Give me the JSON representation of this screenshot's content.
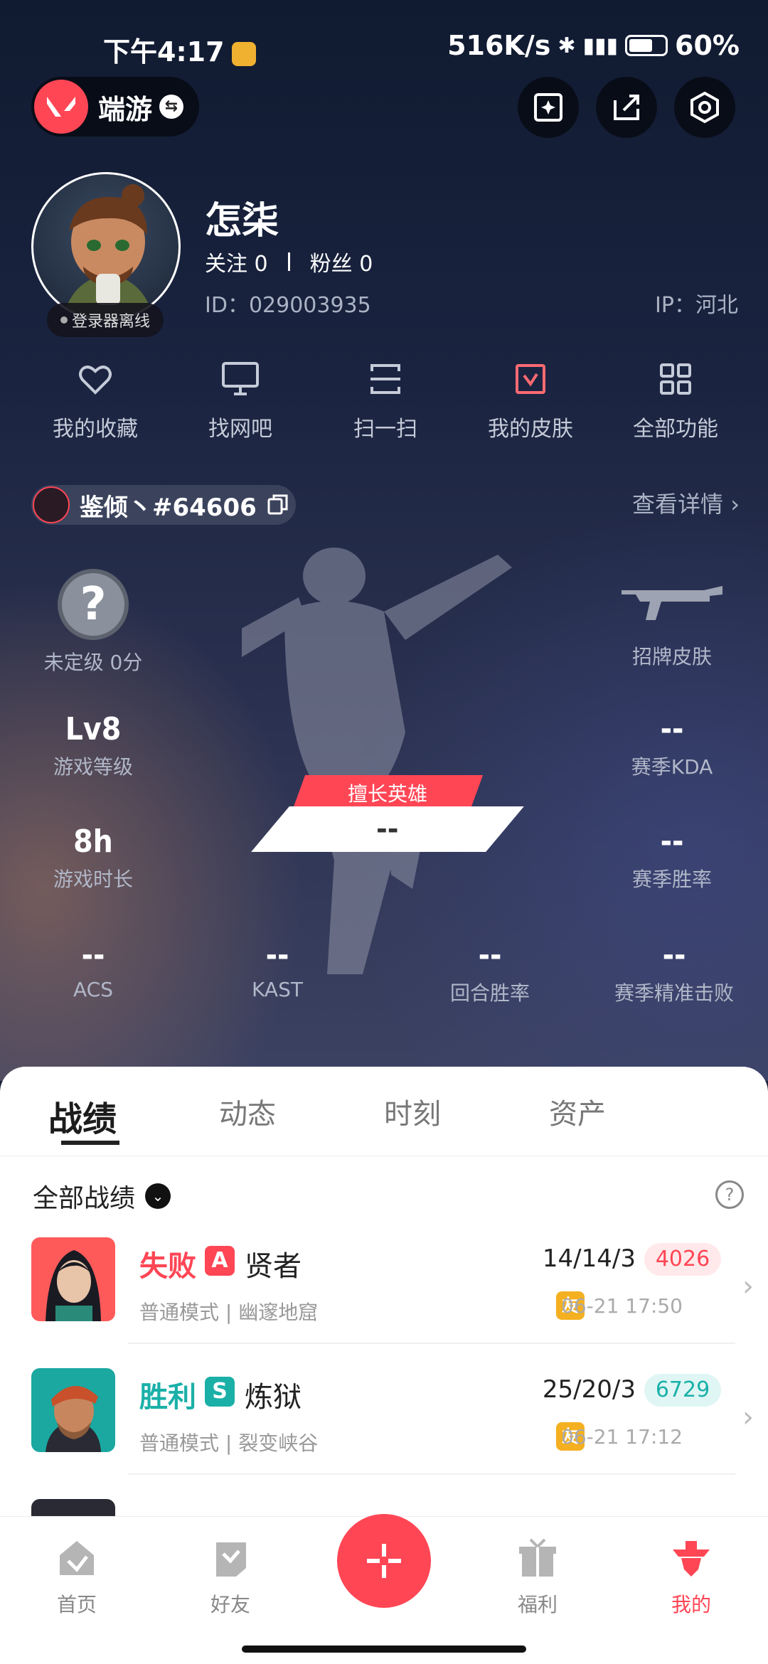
{
  "status": {
    "time": "下午4:17",
    "net": "516K/s",
    "battery": "60%"
  },
  "topbar": {
    "app_switch_label": "端游"
  },
  "profile": {
    "nickname": "怎柒",
    "follow_label": "关注",
    "follow_count": "0",
    "fans_label": "粉丝",
    "fans_count": "0",
    "id_text": "ID：029003935",
    "ip_text": "IP：河北",
    "status_text": "登录器离线"
  },
  "quick_actions": [
    {
      "label": "我的收藏",
      "icon": "heart-icon"
    },
    {
      "label": "找网吧",
      "icon": "monitor-icon"
    },
    {
      "label": "扫一扫",
      "icon": "scan-icon"
    },
    {
      "label": "我的皮肤",
      "icon": "skin-icon"
    },
    {
      "label": "全部功能",
      "icon": "grid-icon"
    }
  ],
  "player": {
    "tag": "鉴倾丶#64606",
    "details_label": "查看详情 ›"
  },
  "stats": {
    "rank": {
      "value": "?",
      "label": "未定级 0分"
    },
    "signature_skin": {
      "label": "招牌皮肤"
    },
    "level": {
      "value": "Lv8",
      "label": "游戏等级"
    },
    "kda": {
      "value": "--",
      "label": "赛季KDA"
    },
    "playtime": {
      "value": "8h",
      "label": "游戏时长"
    },
    "winrate": {
      "value": "--",
      "label": "赛季胜率"
    },
    "best_hero": {
      "label": "擅长英雄",
      "value": "--"
    },
    "acs": {
      "value": "--",
      "label": "ACS"
    },
    "kast": {
      "value": "--",
      "label": "KAST"
    },
    "round_win": {
      "value": "--",
      "label": "回合胜率"
    },
    "precise_kill": {
      "value": "--",
      "label": "赛季精准击败"
    }
  },
  "tabs": [
    {
      "label": "战绩",
      "active": true
    },
    {
      "label": "动态",
      "active": false
    },
    {
      "label": "时刻",
      "active": false
    },
    {
      "label": "资产",
      "active": false
    }
  ],
  "filter": {
    "label": "全部战绩"
  },
  "matches": [
    {
      "result": "失败",
      "result_color": "#ff4655",
      "rank": "A",
      "rank_color": "#ff4655",
      "agent": "贤者",
      "mode": "普通模式 | 幽邃地窟",
      "kda": "14/14/3",
      "score": "4026",
      "score_bg": "#ffe9eb",
      "score_color": "#ff4655",
      "badge": "友",
      "time": "06-21 17:50"
    },
    {
      "result": "胜利",
      "result_color": "#1ab0a8",
      "rank": "S",
      "rank_color": "#1ab0a8",
      "agent": "炼狱",
      "mode": "普通模式 | 裂变峡谷",
      "kda": "25/20/3",
      "score": "6729",
      "score_bg": "#dff6f4",
      "score_color": "#1ab0a8",
      "badge": "友",
      "time": "06-21 17:12"
    }
  ],
  "nav": [
    {
      "label": "首页",
      "icon": "home-icon"
    },
    {
      "label": "好友",
      "icon": "friends-icon"
    },
    {
      "label": "福利",
      "icon": "gift-icon"
    },
    {
      "label": "我的",
      "icon": "profile-icon"
    }
  ]
}
